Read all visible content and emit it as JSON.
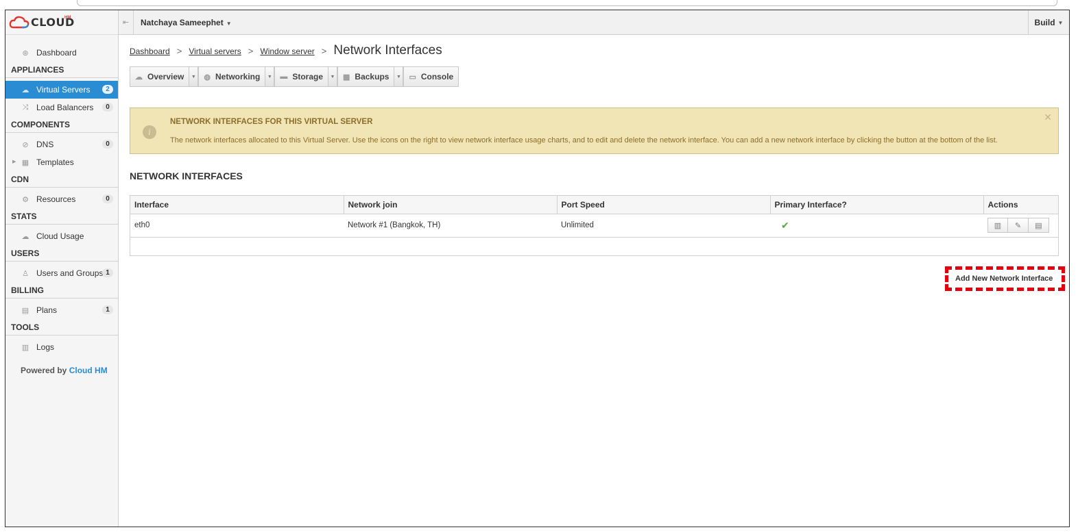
{
  "brand": {
    "logo_text": "CLOUD",
    "logo_sup": "HM"
  },
  "topbar": {
    "user": "Natchaya Sameephet",
    "build": "Build"
  },
  "sidebar": {
    "dashboard": "Dashboard",
    "sections": [
      {
        "title": "APPLIANCES"
      },
      {
        "title": "COMPONENTS"
      },
      {
        "title": "CDN"
      },
      {
        "title": "STATS"
      },
      {
        "title": "USERS"
      },
      {
        "title": "BILLING"
      },
      {
        "title": "TOOLS"
      }
    ],
    "items": {
      "virtual_servers": {
        "label": "Virtual Servers",
        "count": "2"
      },
      "load_balancers": {
        "label": "Load Balancers",
        "count": "0"
      },
      "dns": {
        "label": "DNS",
        "count": "0"
      },
      "templates": {
        "label": "Templates"
      },
      "resources": {
        "label": "Resources",
        "count": "0"
      },
      "cloud_usage": {
        "label": "Cloud Usage"
      },
      "users_groups": {
        "label": "Users and Groups",
        "count": "1"
      },
      "plans": {
        "label": "Plans",
        "count": "1"
      },
      "logs": {
        "label": "Logs"
      }
    },
    "powered_prefix": "Powered by",
    "powered_link": "Cloud HM"
  },
  "breadcrumb": {
    "dashboard": "Dashboard",
    "virtual_servers": "Virtual servers",
    "window_server": "Window server",
    "current": "Network Interfaces"
  },
  "tabs": {
    "overview": "Overview",
    "networking": "Networking",
    "storage": "Storage",
    "backups": "Backups",
    "console": "Console"
  },
  "notice": {
    "title": "NETWORK INTERFACES FOR THIS VIRTUAL SERVER",
    "body": "The network interfaces allocated to this Virtual Server. Use the icons on the right to view network interface usage charts, and to edit and delete the network interface. You can add a new network interface by clicking the button at the bottom of the list."
  },
  "section_heading": "NETWORK INTERFACES",
  "table": {
    "headers": [
      "Interface",
      "Network join",
      "Port Speed",
      "Primary Interface?",
      "Actions"
    ],
    "rows": [
      {
        "interface": "eth0",
        "network": "Network #1 (Bangkok, TH)",
        "speed": "Unlimited",
        "primary": true
      }
    ]
  },
  "add_button": "Add New Network Interface",
  "colors": {
    "accent": "#2a8dd4",
    "notice_bg": "#f1e5b5",
    "highlight": "#e3000f",
    "check": "#5aa83a"
  },
  "icons": [
    "dashboard-icon",
    "cloud-icon",
    "shuffle-icon",
    "dns-icon",
    "templates-icon",
    "resources-icon",
    "cloud-usage-icon",
    "users-icon",
    "plans-icon",
    "logs-icon",
    "globe-icon",
    "disk-icon",
    "backups-icon",
    "console-icon",
    "info-icon",
    "close-icon",
    "check-icon",
    "chart-icon",
    "pencil-icon",
    "trash-icon"
  ]
}
